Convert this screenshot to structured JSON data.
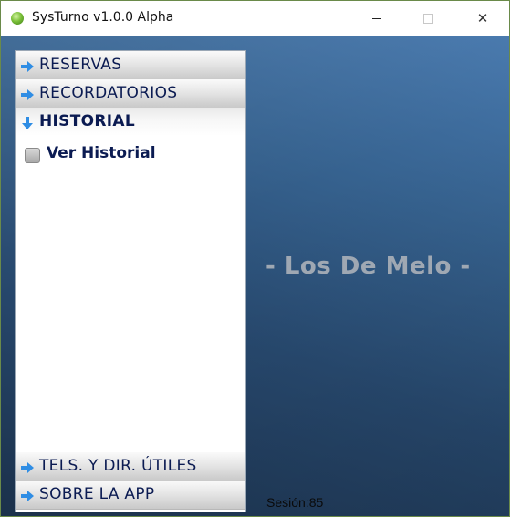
{
  "window": {
    "title": "SysTurno v1.0.0 Alpha",
    "icon": "app-orb-icon",
    "controls": {
      "minimize": "minimize-icon",
      "maximize": "maximize-icon",
      "close_glyph": "✕"
    }
  },
  "sidebar": {
    "top_items": [
      {
        "label": "RESERVAS",
        "icon": "arrow-right-icon",
        "expanded": false
      },
      {
        "label": "RECORDATORIOS",
        "icon": "arrow-right-icon",
        "expanded": false
      },
      {
        "label": "HISTORIAL",
        "icon": "arrow-down-icon",
        "expanded": true
      }
    ],
    "sub_items": [
      {
        "label": "Ver Historial",
        "icon": "checkbox-icon"
      }
    ],
    "bottom_items": [
      {
        "label": "TELS. Y DIR. ÚTILES",
        "icon": "arrow-right-icon",
        "expanded": false
      },
      {
        "label": "SOBRE LA APP",
        "icon": "arrow-right-icon",
        "expanded": false
      }
    ]
  },
  "main": {
    "brand_text": "- Los De Melo -",
    "session_text": "Sesión:85"
  },
  "colors": {
    "nav_text": "#0b1b52",
    "background_top": "#4778ad",
    "background_bottom": "#1d3450",
    "brand_text": "#9fa8b3",
    "arrow_icon": "#2f8de4"
  }
}
